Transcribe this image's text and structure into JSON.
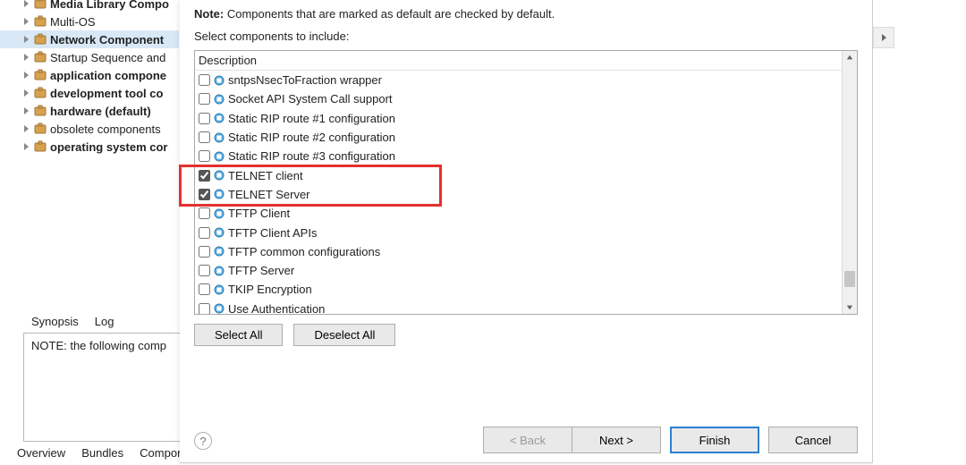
{
  "tree": {
    "items": [
      {
        "label": "Media Library Compo",
        "bold": true,
        "indent": 22
      },
      {
        "label": "Multi-OS",
        "bold": false,
        "indent": 22
      },
      {
        "label": "Network Component",
        "bold": true,
        "indent": 22,
        "selected": true
      },
      {
        "label": "Startup Sequence and",
        "bold": false,
        "indent": 22
      },
      {
        "label": "application compone",
        "bold": true,
        "indent": 22
      },
      {
        "label": "development tool co",
        "bold": true,
        "indent": 22
      },
      {
        "label": "hardware (default)",
        "bold": true,
        "indent": 22
      },
      {
        "label": "obsolete components",
        "bold": false,
        "indent": 22
      },
      {
        "label": "operating system cor",
        "bold": true,
        "indent": 22
      }
    ]
  },
  "lower_tabs": {
    "synopsis": "Synopsis",
    "log": "Log"
  },
  "log_text": "NOTE: the following comp",
  "bottom_tabs": {
    "overview": "Overview",
    "bundles": "Bundles",
    "compone": "Compone"
  },
  "dialog": {
    "note_bold": "Note:",
    "note_rest": " Components that are marked as default are checked by default.",
    "select_components": "Select components to include:",
    "desc_header": "Description",
    "items": [
      {
        "label": "sntpsNsecToFraction wrapper",
        "checked": false
      },
      {
        "label": "Socket API System Call support",
        "checked": false
      },
      {
        "label": "Static RIP route #1 configuration",
        "checked": false
      },
      {
        "label": "Static RIP route #2 configuration",
        "checked": false
      },
      {
        "label": "Static RIP route #3 configuration",
        "checked": false
      },
      {
        "label": "TELNET client",
        "checked": true
      },
      {
        "label": "TELNET Server",
        "checked": true
      },
      {
        "label": "TFTP Client",
        "checked": false
      },
      {
        "label": "TFTP Client APIs",
        "checked": false
      },
      {
        "label": "TFTP common configurations",
        "checked": false
      },
      {
        "label": "TFTP Server",
        "checked": false
      },
      {
        "label": "TKIP Encryption",
        "checked": false
      },
      {
        "label": "Use Authentication",
        "checked": false
      }
    ],
    "select_all": "Select All",
    "deselect_all": "Deselect All",
    "back": "< Back",
    "next": "Next >",
    "finish": "Finish",
    "cancel": "Cancel",
    "help": "?"
  }
}
